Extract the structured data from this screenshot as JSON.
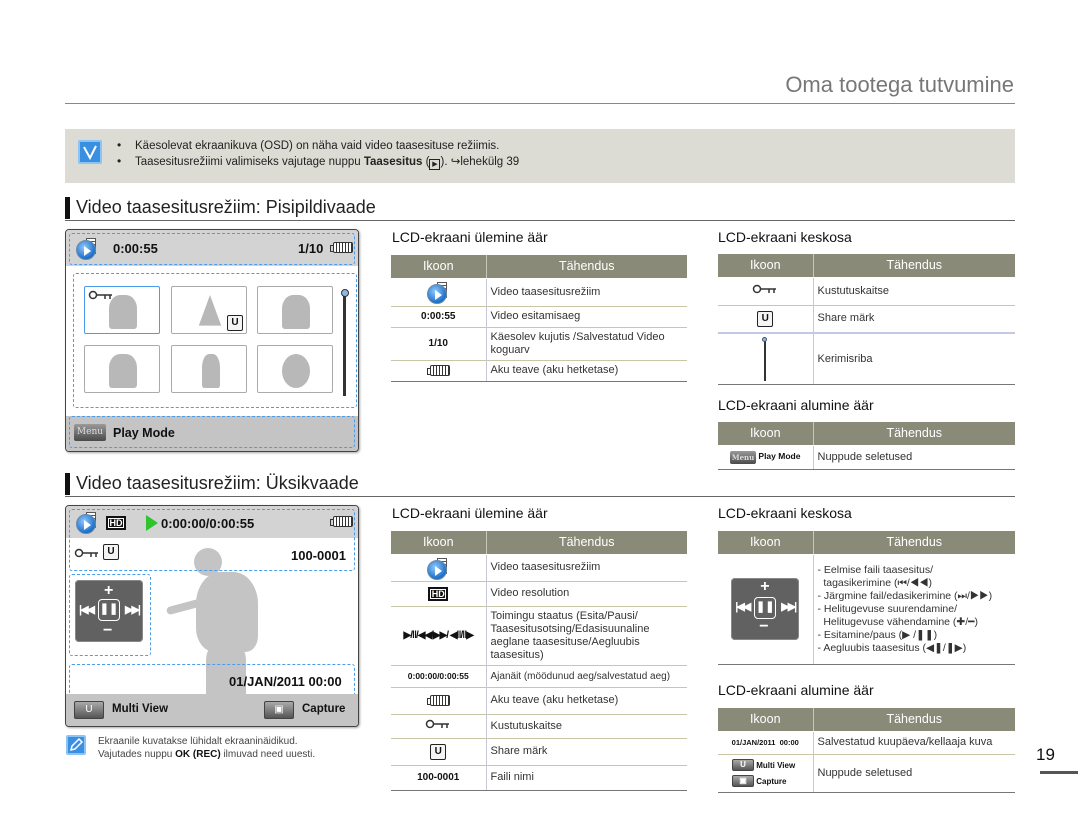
{
  "header": {
    "title": "Oma tootega tutvumine"
  },
  "note": {
    "icon": "checkmark-note-icon",
    "items": [
      "Käesolevat ekraanikuva (OSD) on näha vaid video taasesituse režiimis.",
      "Taasesitusrežiimi valimiseks vajutage nuppu"
    ],
    "item2_bold": "Taasesitus",
    "item2_suffix": "). ↪lehekülg 39"
  },
  "thumbnail_section": {
    "heading": "Video taasesitusrežiim: Pisipildivaade",
    "lcd": {
      "time": "0:00:55",
      "counter": "1/10",
      "bottom_label": "Play Mode",
      "menu_button": "Menu"
    },
    "top_table": {
      "heading": "LCD-ekraani ülemine äär",
      "columns": [
        "Ikoon",
        "Tähendus"
      ],
      "rows": [
        {
          "icon": "video-playback-mode-icon",
          "icon_text": "",
          "meaning": "Video taasesitusrežiim"
        },
        {
          "icon": "",
          "icon_text": "0:00:55",
          "meaning": "Video esitamisaeg"
        },
        {
          "icon": "",
          "icon_text": "1/10",
          "meaning": "Käesolev kujutis /Salvestatud Video koguarv"
        },
        {
          "icon": "battery-icon",
          "icon_text": "",
          "meaning": "Aku teave (aku hetketase)"
        }
      ]
    },
    "center_table": {
      "heading": "LCD-ekraani keskosa",
      "columns": [
        "Ikoon",
        "Tähendus"
      ],
      "rows": [
        {
          "icon": "protect-key-icon",
          "meaning": "Kustutuskaitse"
        },
        {
          "icon": "share-mark-icon",
          "meaning": "Share märk"
        },
        {
          "icon": "scrollbar-icon",
          "meaning": "Kerimisriba"
        }
      ]
    },
    "bottom_table": {
      "heading": "LCD-ekraani alumine äär",
      "columns": [
        "Ikoon",
        "Tähendus"
      ],
      "rows": [
        {
          "icon": "menu-button-icon",
          "icon_text": "Play Mode",
          "meaning": "Nuppude seletused"
        }
      ]
    }
  },
  "single_section": {
    "heading": "Video taasesitusrežiim: Üksikvaade",
    "lcd": {
      "time": "0:00:00/0:00:55",
      "file_name": "100-0001",
      "datetime": "01/JAN/2011 00:00",
      "multi_view_label": "Multi View",
      "capture_label": "Capture",
      "hd_label": "HD"
    },
    "tip": {
      "line1": "Ekraanile kuvatakse lühidalt ekraaninäidikud.",
      "line2_prefix": "Vajutades nuppu ",
      "line2_bold": "OK (REC)",
      "line2_suffix": " ilmuvad need uuesti."
    },
    "top_table": {
      "heading": "LCD-ekraani ülemine äär",
      "columns": [
        "Ikoon",
        "Tähendus"
      ],
      "rows": [
        {
          "icon": "video-playback-mode-icon",
          "icon_text": "",
          "meaning": "Video taasesitusrežiim"
        },
        {
          "icon": "hd-resolution-icon",
          "icon_text": "",
          "meaning": "Video resolution"
        },
        {
          "icon": "playback-status-icons",
          "icon_text": "▶/‖/◀◀/▶▶/ ◀‖/‖▶",
          "meaning": "Toimingu staatus (Esita/Pausi/ Taasesitusotsing/Edasisuunaline aeglane taasesituse/Aegluubis taasesitus)"
        },
        {
          "icon": "",
          "icon_text": "0:00:00/0:00:55",
          "meaning": "Ajanäit (möödunud aeg/salvestatud aeg)"
        },
        {
          "icon": "battery-icon",
          "icon_text": "",
          "meaning": "Aku teave (aku hetketase)"
        },
        {
          "icon": "protect-key-icon",
          "icon_text": "",
          "meaning": "Kustutuskaitse"
        },
        {
          "icon": "share-mark-icon",
          "icon_text": "",
          "meaning": "Share märk"
        },
        {
          "icon": "",
          "icon_text": "100-0001",
          "meaning": "Faili nimi"
        }
      ]
    },
    "center_table": {
      "heading": "LCD-ekraani keskosa",
      "columns": [
        "Ikoon",
        "Tähendus"
      ],
      "rows": [
        {
          "icon": "playback-control-pad-icon",
          "meaning_lines": [
            "- Eelmise faili taasesitus/",
            "  tagasikerimine (⏮/◀◀)",
            "- Järgmine fail/edasikerimine (⏭/▶▶)",
            "- Helitugevuse suurendamine/",
            "  Helitugevuse vähendamine (✚/━)",
            "- Esitamine/paus (▶ /❚❚)",
            "- Aegluubis taasesitus (◀❚/❚▶)"
          ]
        }
      ]
    },
    "bottom_table": {
      "heading": "LCD-ekraani alumine äär",
      "columns": [
        "Ikoon",
        "Tähendus"
      ],
      "rows": [
        {
          "icon": "",
          "icon_text": "01/JAN/2011  00:00",
          "meaning": "Salvestatud kuupäeva/kellaaja kuva"
        },
        {
          "icon": "multi-view-capture-buttons-icon",
          "icon_text_1": "Multi View",
          "icon_text_2": "Capture",
          "meaning": "Nuppude seletused"
        }
      ]
    }
  },
  "page_number": "19"
}
